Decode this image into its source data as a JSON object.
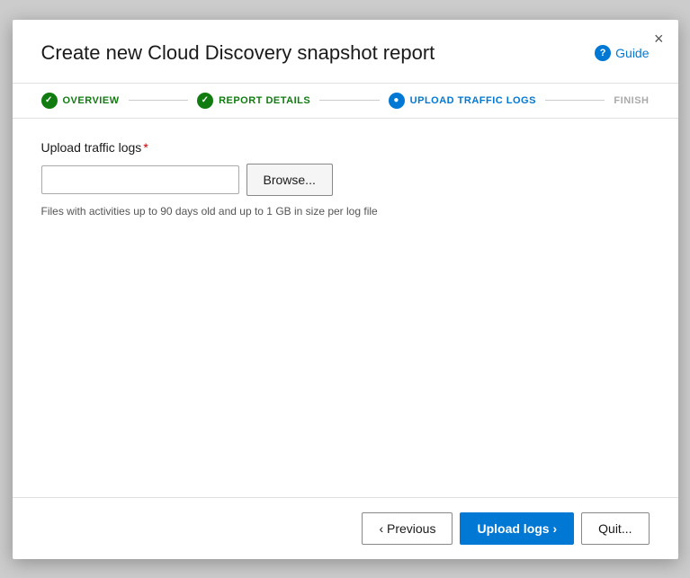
{
  "dialog": {
    "title": "Create new Cloud Discovery snapshot report",
    "close_label": "×"
  },
  "guide": {
    "label": "Guide",
    "icon_text": "?"
  },
  "stepper": {
    "steps": [
      {
        "id": "overview",
        "label": "OVERVIEW",
        "state": "completed"
      },
      {
        "id": "report-details",
        "label": "REPORT DETAILS",
        "state": "completed"
      },
      {
        "id": "upload-traffic-logs",
        "label": "UPLOAD TRAFFIC LOGS",
        "state": "active"
      },
      {
        "id": "finish",
        "label": "FINISH",
        "state": "inactive"
      }
    ]
  },
  "content": {
    "field_label": "Upload traffic logs",
    "required_indicator": "*",
    "file_input_placeholder": "",
    "browse_button_label": "Browse...",
    "hint_text": "Files with activities up to 90 days old and up to 1 GB in size per log file"
  },
  "footer": {
    "previous_label": "‹ Previous",
    "upload_label": "Upload logs ›",
    "quit_label": "Quit..."
  }
}
